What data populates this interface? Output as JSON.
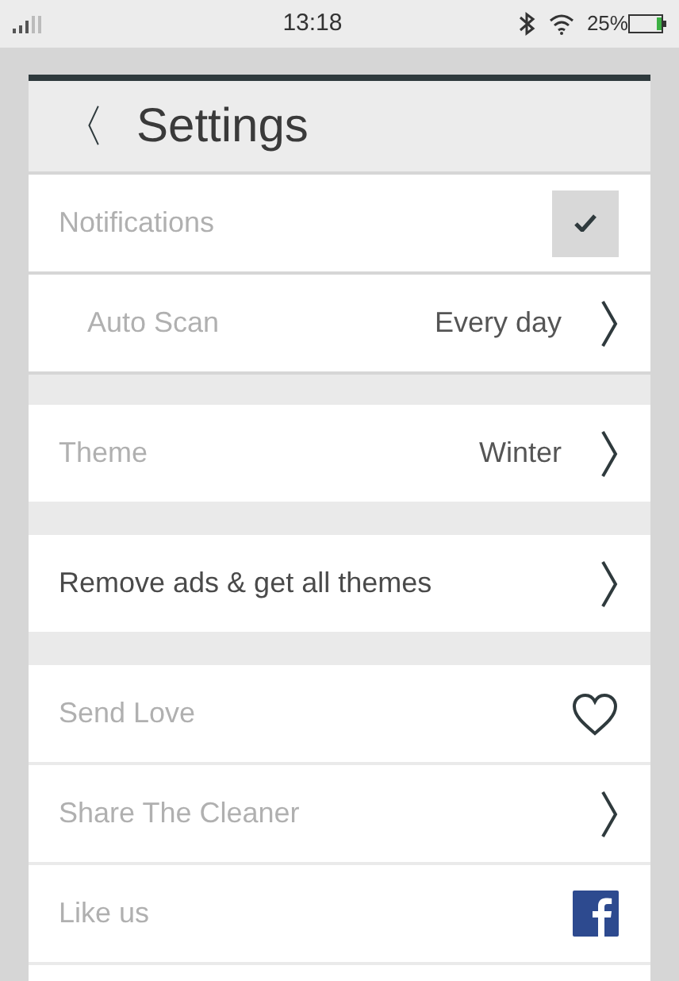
{
  "status_bar": {
    "time": "13:18",
    "battery": "25%"
  },
  "header": {
    "back": "〈",
    "title": "Settings"
  },
  "sections": [
    {
      "rows": [
        {
          "kind": "checkbox",
          "label": "Notifications",
          "checked": true,
          "children": [
            {
              "kind": "value",
              "label": "Auto Scan",
              "value": "Every day"
            }
          ]
        }
      ]
    },
    {
      "rows": [
        {
          "kind": "value",
          "label": "Theme",
          "value": "Winter"
        }
      ]
    },
    {
      "rows": [
        {
          "kind": "promo",
          "label": "Remove ads & get all themes"
        }
      ]
    },
    {
      "rows": [
        {
          "kind": "heart",
          "label": "Send Love"
        },
        {
          "kind": "link",
          "label": "Share The Cleaner"
        },
        {
          "kind": "facebook",
          "label": "Like us"
        },
        {
          "kind": "blank"
        }
      ]
    }
  ]
}
